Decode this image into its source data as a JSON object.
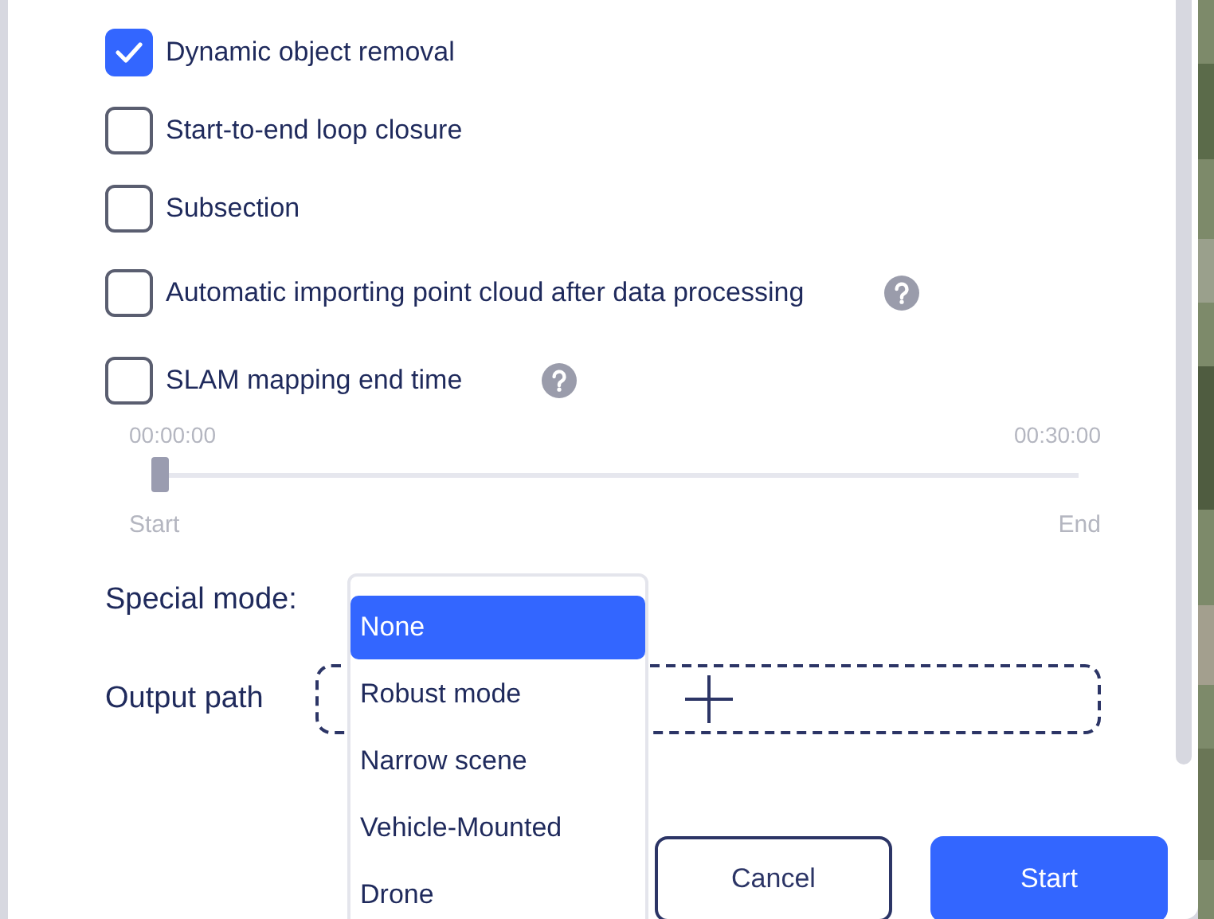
{
  "options": [
    {
      "label": "Dynamic object removal",
      "checked": true,
      "help": false
    },
    {
      "label": "Start-to-end loop closure",
      "checked": false,
      "help": false
    },
    {
      "label": "Subsection",
      "checked": false,
      "help": false
    },
    {
      "label": "Automatic importing point cloud after data processing",
      "checked": false,
      "help": true
    },
    {
      "label": "SLAM mapping end time",
      "checked": false,
      "help": true
    }
  ],
  "slider": {
    "start_time": "00:00:00",
    "end_time": "00:30:00",
    "level": 0,
    "start_label": "Start",
    "end_label": "End"
  },
  "special_mode": {
    "label": "Special mode:",
    "options": [
      {
        "label": "None",
        "selected": true
      },
      {
        "label": "Robust mode",
        "selected": false
      },
      {
        "label": "Narrow scene",
        "selected": false
      },
      {
        "label": "Vehicle-Mounted",
        "selected": false
      },
      {
        "label": "Drone",
        "selected": false
      }
    ]
  },
  "output_path": {
    "label": "Output path"
  },
  "buttons": [
    {
      "label": "Cancel",
      "kind": "secondary"
    },
    {
      "label": "Start",
      "kind": "primary"
    }
  ]
}
